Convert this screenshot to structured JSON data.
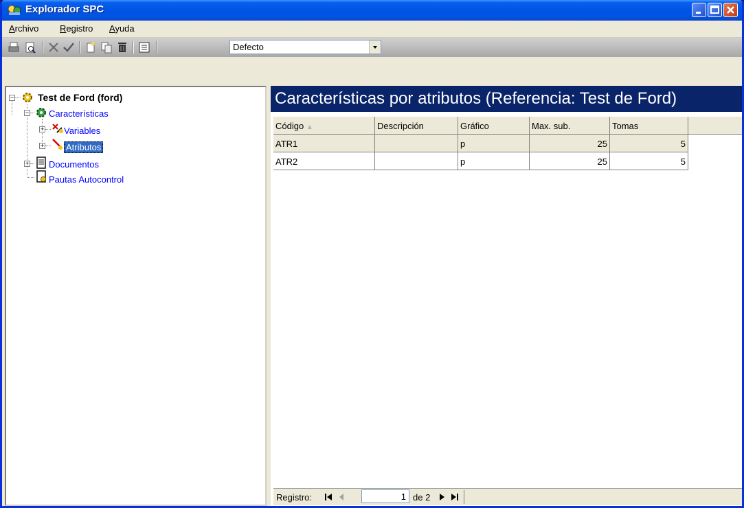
{
  "window": {
    "title": "Explorador SPC"
  },
  "menu": [
    "Archivo",
    "Registro",
    "Ayuda"
  ],
  "toolbar": {
    "combo_value": "Defecto"
  },
  "tree": {
    "root": "Test de Ford (ford)",
    "caracteristicas": "Características",
    "variables": "Variables",
    "atributos": "Atributos",
    "documentos": "Documentos",
    "pautas": "Pautas Autocontrol"
  },
  "panel": {
    "title": "Características por atributos (Referencia: Test de Ford)"
  },
  "table": {
    "headers": [
      "Código",
      "Descripción",
      "Gráfico",
      "Max. sub.",
      "Tomas"
    ],
    "rows": [
      [
        "ATR1",
        "",
        "p",
        "25",
        "5"
      ],
      [
        "ATR2",
        "",
        "p",
        "25",
        "5"
      ]
    ]
  },
  "nav": {
    "label": "Registro:",
    "current": "1",
    "total": "de 2"
  },
  "colors": {
    "title_bar": "#0054e3",
    "panel_header": "#0a246a",
    "link": "#0000ff"
  }
}
